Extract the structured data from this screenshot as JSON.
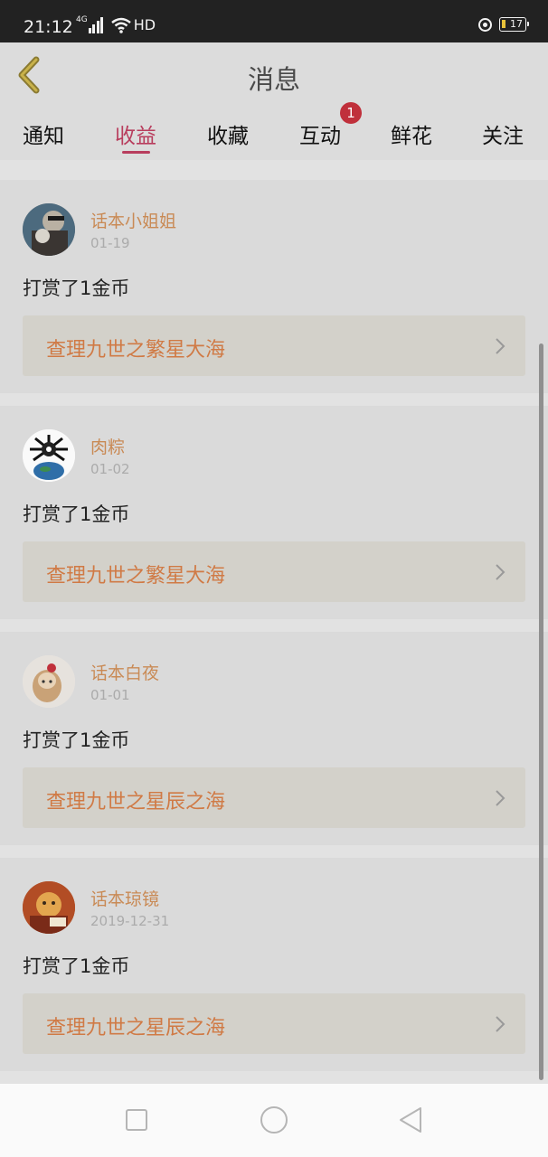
{
  "status_bar": {
    "time": "21:12",
    "network": "4G",
    "hd": "HD",
    "battery": "17"
  },
  "header": {
    "title": "消息",
    "back_icon": "chevron-left-icon"
  },
  "tabs": [
    {
      "label": "通知",
      "active": false
    },
    {
      "label": "收益",
      "active": true
    },
    {
      "label": "收藏",
      "active": false
    },
    {
      "label": "互动",
      "active": false,
      "badge": "1"
    },
    {
      "label": "鲜花",
      "active": false
    },
    {
      "label": "关注",
      "active": false
    }
  ],
  "messages": [
    {
      "name": "话本小姐姐",
      "date": "01-19",
      "text": "打赏了1金币",
      "link": "查理九世之繁星大海"
    },
    {
      "name": "肉粽",
      "date": "01-02",
      "text": "打赏了1金币",
      "link": "查理九世之繁星大海"
    },
    {
      "name": "话本白夜",
      "date": "01-01",
      "text": "打赏了1金币",
      "link": "查理九世之星辰之海"
    },
    {
      "name": "话本琼镜",
      "date": "2019-12-31",
      "text": "打赏了1金币",
      "link": "查理九世之星辰之海"
    }
  ],
  "nav_bar": {
    "icons": [
      "recent-apps-icon",
      "home-icon",
      "back-icon"
    ]
  },
  "colors": {
    "accent": "#b83d5d",
    "name": "#c98a55",
    "link": "#d07a45",
    "badge": "#c0303b"
  }
}
